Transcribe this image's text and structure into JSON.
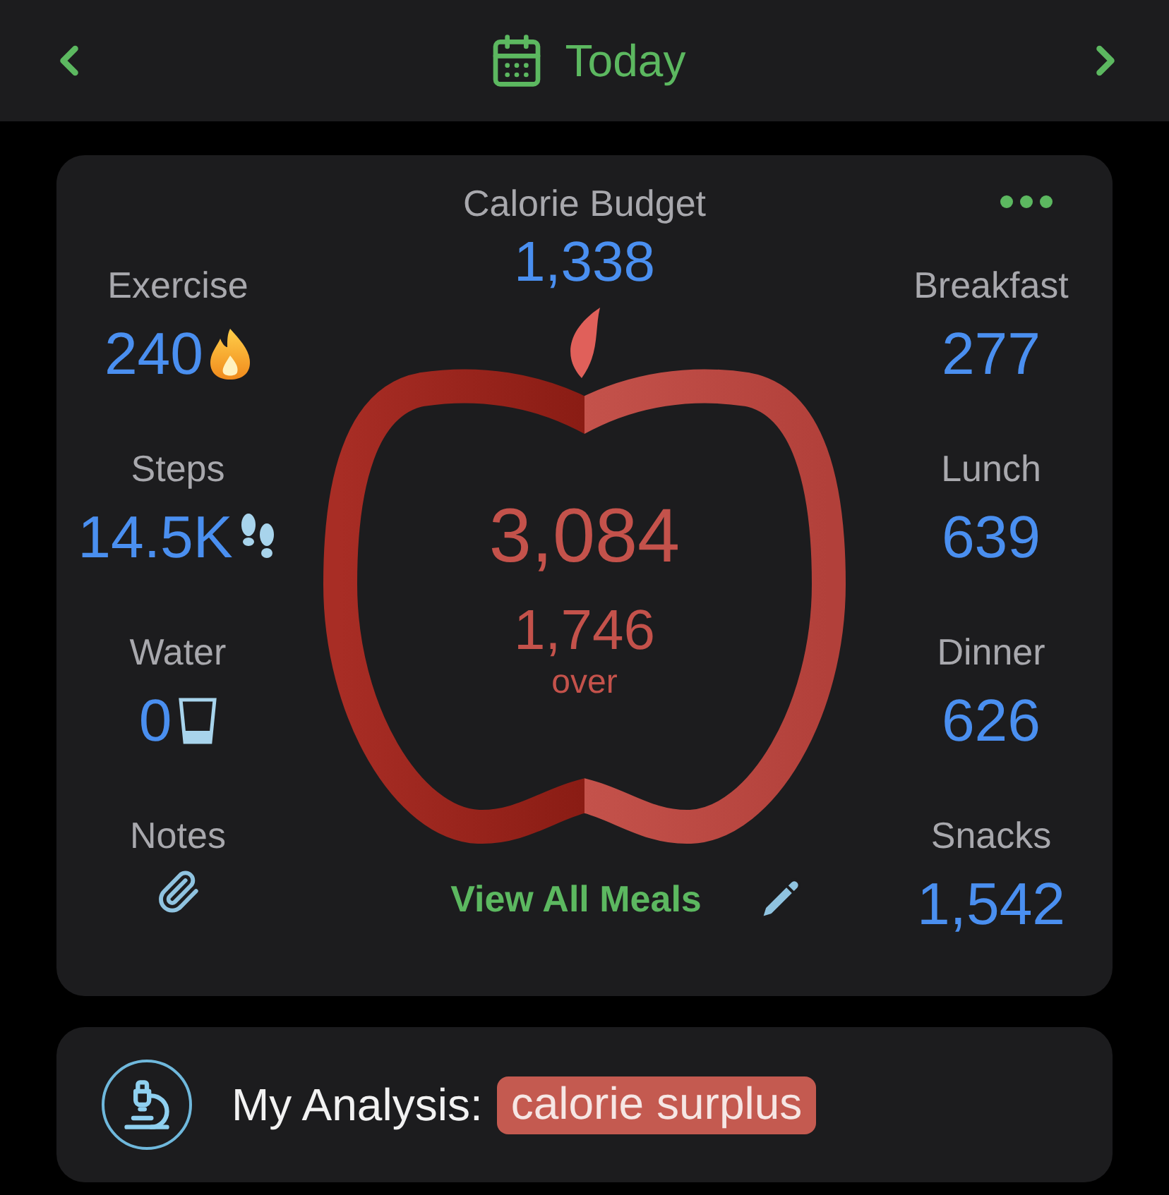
{
  "header": {
    "title": "Today"
  },
  "budget": {
    "label": "Calorie Budget",
    "value": "1,338"
  },
  "stats": [
    {
      "kind": "flame",
      "label": "Exercise",
      "value": "240"
    },
    {
      "kind": "footprints",
      "label": "Steps",
      "value": "14.5K"
    },
    {
      "kind": "glass",
      "label": "Water",
      "value": "0"
    },
    {
      "kind": "clip",
      "label": "Notes"
    }
  ],
  "meals": [
    {
      "label": "Breakfast",
      "value": "277"
    },
    {
      "label": "Lunch",
      "value": "639"
    },
    {
      "label": "Dinner",
      "value": "626"
    },
    {
      "label": "Snacks",
      "value": "1,542"
    }
  ],
  "apple": {
    "consumed": "3,084",
    "difference": "1,746",
    "status": "over"
  },
  "view_all": "View All Meals",
  "analysis": {
    "label": "My Analysis:",
    "result": "calorie surplus"
  }
}
